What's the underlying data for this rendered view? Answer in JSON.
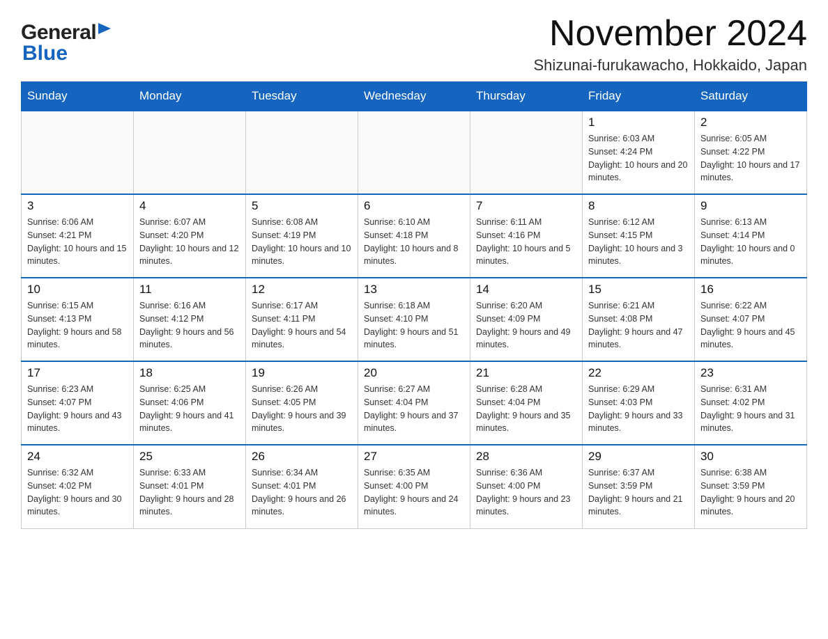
{
  "header": {
    "logo_general": "General",
    "logo_blue": "Blue",
    "month_title": "November 2024",
    "location": "Shizunai-furukawacho, Hokkaido, Japan"
  },
  "calendar": {
    "days_of_week": [
      "Sunday",
      "Monday",
      "Tuesday",
      "Wednesday",
      "Thursday",
      "Friday",
      "Saturday"
    ],
    "weeks": [
      [
        {
          "day": "",
          "sunrise": "",
          "sunset": "",
          "daylight": ""
        },
        {
          "day": "",
          "sunrise": "",
          "sunset": "",
          "daylight": ""
        },
        {
          "day": "",
          "sunrise": "",
          "sunset": "",
          "daylight": ""
        },
        {
          "day": "",
          "sunrise": "",
          "sunset": "",
          "daylight": ""
        },
        {
          "day": "",
          "sunrise": "",
          "sunset": "",
          "daylight": ""
        },
        {
          "day": "1",
          "sunrise": "Sunrise: 6:03 AM",
          "sunset": "Sunset: 4:24 PM",
          "daylight": "Daylight: 10 hours and 20 minutes."
        },
        {
          "day": "2",
          "sunrise": "Sunrise: 6:05 AM",
          "sunset": "Sunset: 4:22 PM",
          "daylight": "Daylight: 10 hours and 17 minutes."
        }
      ],
      [
        {
          "day": "3",
          "sunrise": "Sunrise: 6:06 AM",
          "sunset": "Sunset: 4:21 PM",
          "daylight": "Daylight: 10 hours and 15 minutes."
        },
        {
          "day": "4",
          "sunrise": "Sunrise: 6:07 AM",
          "sunset": "Sunset: 4:20 PM",
          "daylight": "Daylight: 10 hours and 12 minutes."
        },
        {
          "day": "5",
          "sunrise": "Sunrise: 6:08 AM",
          "sunset": "Sunset: 4:19 PM",
          "daylight": "Daylight: 10 hours and 10 minutes."
        },
        {
          "day": "6",
          "sunrise": "Sunrise: 6:10 AM",
          "sunset": "Sunset: 4:18 PM",
          "daylight": "Daylight: 10 hours and 8 minutes."
        },
        {
          "day": "7",
          "sunrise": "Sunrise: 6:11 AM",
          "sunset": "Sunset: 4:16 PM",
          "daylight": "Daylight: 10 hours and 5 minutes."
        },
        {
          "day": "8",
          "sunrise": "Sunrise: 6:12 AM",
          "sunset": "Sunset: 4:15 PM",
          "daylight": "Daylight: 10 hours and 3 minutes."
        },
        {
          "day": "9",
          "sunrise": "Sunrise: 6:13 AM",
          "sunset": "Sunset: 4:14 PM",
          "daylight": "Daylight: 10 hours and 0 minutes."
        }
      ],
      [
        {
          "day": "10",
          "sunrise": "Sunrise: 6:15 AM",
          "sunset": "Sunset: 4:13 PM",
          "daylight": "Daylight: 9 hours and 58 minutes."
        },
        {
          "day": "11",
          "sunrise": "Sunrise: 6:16 AM",
          "sunset": "Sunset: 4:12 PM",
          "daylight": "Daylight: 9 hours and 56 minutes."
        },
        {
          "day": "12",
          "sunrise": "Sunrise: 6:17 AM",
          "sunset": "Sunset: 4:11 PM",
          "daylight": "Daylight: 9 hours and 54 minutes."
        },
        {
          "day": "13",
          "sunrise": "Sunrise: 6:18 AM",
          "sunset": "Sunset: 4:10 PM",
          "daylight": "Daylight: 9 hours and 51 minutes."
        },
        {
          "day": "14",
          "sunrise": "Sunrise: 6:20 AM",
          "sunset": "Sunset: 4:09 PM",
          "daylight": "Daylight: 9 hours and 49 minutes."
        },
        {
          "day": "15",
          "sunrise": "Sunrise: 6:21 AM",
          "sunset": "Sunset: 4:08 PM",
          "daylight": "Daylight: 9 hours and 47 minutes."
        },
        {
          "day": "16",
          "sunrise": "Sunrise: 6:22 AM",
          "sunset": "Sunset: 4:07 PM",
          "daylight": "Daylight: 9 hours and 45 minutes."
        }
      ],
      [
        {
          "day": "17",
          "sunrise": "Sunrise: 6:23 AM",
          "sunset": "Sunset: 4:07 PM",
          "daylight": "Daylight: 9 hours and 43 minutes."
        },
        {
          "day": "18",
          "sunrise": "Sunrise: 6:25 AM",
          "sunset": "Sunset: 4:06 PM",
          "daylight": "Daylight: 9 hours and 41 minutes."
        },
        {
          "day": "19",
          "sunrise": "Sunrise: 6:26 AM",
          "sunset": "Sunset: 4:05 PM",
          "daylight": "Daylight: 9 hours and 39 minutes."
        },
        {
          "day": "20",
          "sunrise": "Sunrise: 6:27 AM",
          "sunset": "Sunset: 4:04 PM",
          "daylight": "Daylight: 9 hours and 37 minutes."
        },
        {
          "day": "21",
          "sunrise": "Sunrise: 6:28 AM",
          "sunset": "Sunset: 4:04 PM",
          "daylight": "Daylight: 9 hours and 35 minutes."
        },
        {
          "day": "22",
          "sunrise": "Sunrise: 6:29 AM",
          "sunset": "Sunset: 4:03 PM",
          "daylight": "Daylight: 9 hours and 33 minutes."
        },
        {
          "day": "23",
          "sunrise": "Sunrise: 6:31 AM",
          "sunset": "Sunset: 4:02 PM",
          "daylight": "Daylight: 9 hours and 31 minutes."
        }
      ],
      [
        {
          "day": "24",
          "sunrise": "Sunrise: 6:32 AM",
          "sunset": "Sunset: 4:02 PM",
          "daylight": "Daylight: 9 hours and 30 minutes."
        },
        {
          "day": "25",
          "sunrise": "Sunrise: 6:33 AM",
          "sunset": "Sunset: 4:01 PM",
          "daylight": "Daylight: 9 hours and 28 minutes."
        },
        {
          "day": "26",
          "sunrise": "Sunrise: 6:34 AM",
          "sunset": "Sunset: 4:01 PM",
          "daylight": "Daylight: 9 hours and 26 minutes."
        },
        {
          "day": "27",
          "sunrise": "Sunrise: 6:35 AM",
          "sunset": "Sunset: 4:00 PM",
          "daylight": "Daylight: 9 hours and 24 minutes."
        },
        {
          "day": "28",
          "sunrise": "Sunrise: 6:36 AM",
          "sunset": "Sunset: 4:00 PM",
          "daylight": "Daylight: 9 hours and 23 minutes."
        },
        {
          "day": "29",
          "sunrise": "Sunrise: 6:37 AM",
          "sunset": "Sunset: 3:59 PM",
          "daylight": "Daylight: 9 hours and 21 minutes."
        },
        {
          "day": "30",
          "sunrise": "Sunrise: 6:38 AM",
          "sunset": "Sunset: 3:59 PM",
          "daylight": "Daylight: 9 hours and 20 minutes."
        }
      ]
    ]
  }
}
